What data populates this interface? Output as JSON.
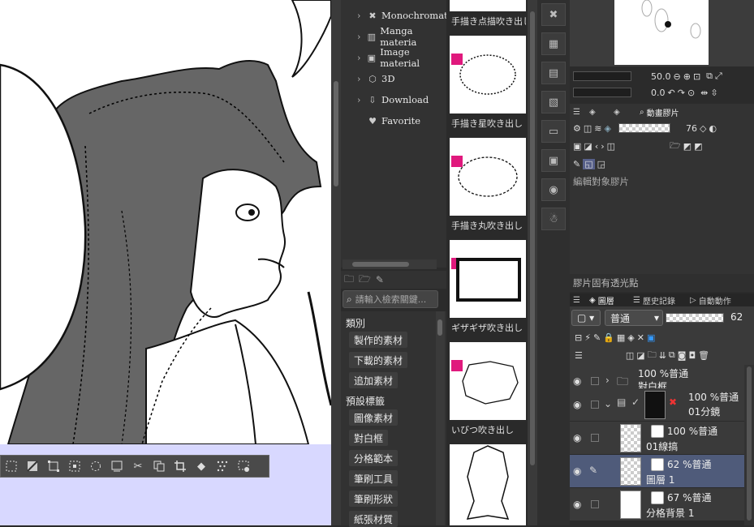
{
  "material_tree": {
    "items": [
      {
        "label": "Monochromati",
        "icon": "x-icon"
      },
      {
        "label": "Manga materia",
        "icon": "manga-frame-icon"
      },
      {
        "label": "Image material",
        "icon": "image-icon"
      },
      {
        "label": "3D",
        "icon": "cube-icon"
      },
      {
        "label": "Download",
        "icon": "download-icon"
      },
      {
        "label": "Favorite",
        "icon": "heart-icon"
      }
    ]
  },
  "search": {
    "placeholder": "請輸入檢索關鍵..."
  },
  "tags": {
    "category_heading": "類別",
    "category_items": [
      "製作的素材",
      "下載的素材",
      "追加素材"
    ],
    "preset_heading": "預設標籤",
    "preset_items": [
      "圖像素材",
      "對白框",
      "分格範本",
      "筆刷工具",
      "筆刷形狀",
      "紙張材質"
    ]
  },
  "thumbnails": {
    "labels": [
      "手描き点描吹き出し",
      "手描き星吹き出し",
      "手描き丸吹き出し",
      "ギザギザ吹き出し",
      "いびつ吹き出し"
    ]
  },
  "navigator": {
    "zoom_value": "50.0",
    "rotate_value": "0.0"
  },
  "layer_property": {
    "tab_label": "動畫膠片",
    "opacity_value": "76",
    "edit_target_label": "編輯對象膠片",
    "bottom_label": "膠片固有透光點"
  },
  "layer_panel": {
    "tabs": [
      "圖層",
      "歷史記錄",
      "自動動作"
    ],
    "blend_mode": "普通",
    "opacity_value": "62",
    "layers": [
      {
        "line1": "100 %普通",
        "line2": "對白框"
      },
      {
        "line1": "100 %普通",
        "line2": "01分鏡"
      },
      {
        "line1": "100 %普通",
        "line2": "01線搞"
      },
      {
        "line1": "62 %普通",
        "line2": "圖層 1"
      },
      {
        "line1": "67 %普通",
        "line2": "分格背景 1"
      }
    ]
  },
  "colors": {
    "accent_pink": "#e0197d",
    "selected_layer": "#4f5b7a",
    "canvas_bg": "#d8d8ff"
  }
}
